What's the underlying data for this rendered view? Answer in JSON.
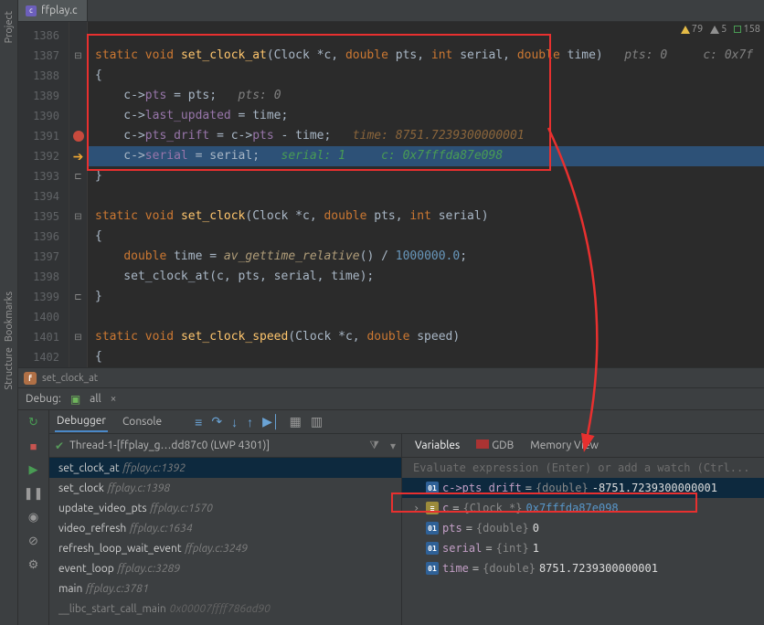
{
  "sidebar": {
    "project": "Project",
    "bookmarks": "Bookmarks",
    "structure": "Structure"
  },
  "tab": {
    "filename": "ffplay.c",
    "icon_letter": "c"
  },
  "inspections": {
    "warn": "79",
    "weak": "5",
    "typo": "158"
  },
  "gutter": [
    "1386",
    "1387",
    "1388",
    "1389",
    "1390",
    "1391",
    "1392",
    "1393",
    "1394",
    "1395",
    "1396",
    "1397",
    "1398",
    "1399",
    "1400",
    "1401",
    "1402"
  ],
  "code": {
    "l0": "",
    "l1_a": "static",
    "l1_b": "void",
    "l1_c": "set_clock_at",
    "l1_d": "(Clock *c, ",
    "l1_e": "double",
    "l1_f": " pts, ",
    "l1_g": "int",
    "l1_h": " serial, ",
    "l1_i": "double",
    "l1_j": " time)",
    "l1_hint": "   pts: 0     c: 0x7f",
    "l2": "{",
    "l3_a": "    c->",
    "l3_b": "pts",
    "l3_c": " = pts;",
    "l3_hint": "   pts: 0",
    "l4_a": "    c->",
    "l4_b": "last_updated",
    "l4_c": " = time;",
    "l5_a": "    c->",
    "l5_b": "pts_drift",
    "l5_c": " = c->",
    "l5_d": "pts",
    "l5_e": " - time;",
    "l5_hint": "   time: 8751.7239300000001",
    "l6_a": "    c->",
    "l6_b": "serial",
    "l6_c": " = serial;",
    "l6_hint1": "   serial: 1",
    "l6_hint2": "     c: 0x7fffda87e098",
    "l7": "}",
    "l8": "",
    "l9_a": "static",
    "l9_b": "void",
    "l9_c": "set_clock",
    "l9_d": "(Clock *c, ",
    "l9_e": "double",
    "l9_f": " pts, ",
    "l9_g": "int",
    "l9_h": " serial)",
    "l10": "{",
    "l11_a": "    ",
    "l11_b": "double",
    "l11_c": " time = ",
    "l11_d": "av_gettime_relative",
    "l11_e": "() / ",
    "l11_f": "1000000.0",
    "l11_g": ";",
    "l12_a": "    set_clock_at(c, pts, serial, time);",
    "l13": "}",
    "l14": "",
    "l15_a": "static",
    "l15_b": "void",
    "l15_c": "set_clock_speed",
    "l15_d": "(Clock *c, ",
    "l15_e": "double",
    "l15_f": " speed)",
    "l16": "{"
  },
  "crumbs": {
    "fn": "set_clock_at"
  },
  "debug": {
    "label": "Debug:",
    "config": "all",
    "tabs": {
      "debugger": "Debugger",
      "console": "Console"
    },
    "thread": "Thread-1-[ffplay_g…dd87c0 (LWP 4301)]",
    "frames": [
      {
        "name": "set_clock_at",
        "loc": "ffplay.c:1392",
        "sel": true
      },
      {
        "name": "set_clock",
        "loc": "ffplay.c:1398"
      },
      {
        "name": "update_video_pts",
        "loc": "ffplay.c:1570"
      },
      {
        "name": "video_refresh",
        "loc": "ffplay.c:1634"
      },
      {
        "name": "refresh_loop_wait_event",
        "loc": "ffplay.c:3249"
      },
      {
        "name": "event_loop",
        "loc": "ffplay.c:3289"
      },
      {
        "name": "main",
        "loc": "ffplay.c:3781"
      },
      {
        "name": "__libc_start_call_main",
        "loc": "0x00007ffff786ad90",
        "dim": true
      }
    ],
    "vars_tabs": {
      "variables": "Variables",
      "gdb": "GDB",
      "memory": "Memory View"
    },
    "watch_hint": "Evaluate expression (Enter) or add a watch (Ctrl...",
    "vars": [
      {
        "name": "c->pts_drift",
        "type": "{double}",
        "val": "-8751.7239300000001",
        "sel": true,
        "icon": "01"
      },
      {
        "name": "c",
        "type": "{Clock *}",
        "val": "0x7fffda87e098",
        "addr": true,
        "icon": "obj",
        "expander": true
      },
      {
        "name": "pts",
        "type": "{double}",
        "val": "0",
        "icon": "01"
      },
      {
        "name": "serial",
        "type": "{int}",
        "val": "1",
        "icon": "01"
      },
      {
        "name": "time",
        "type": "{double}",
        "val": "8751.7239300000001",
        "icon": "01"
      }
    ]
  }
}
